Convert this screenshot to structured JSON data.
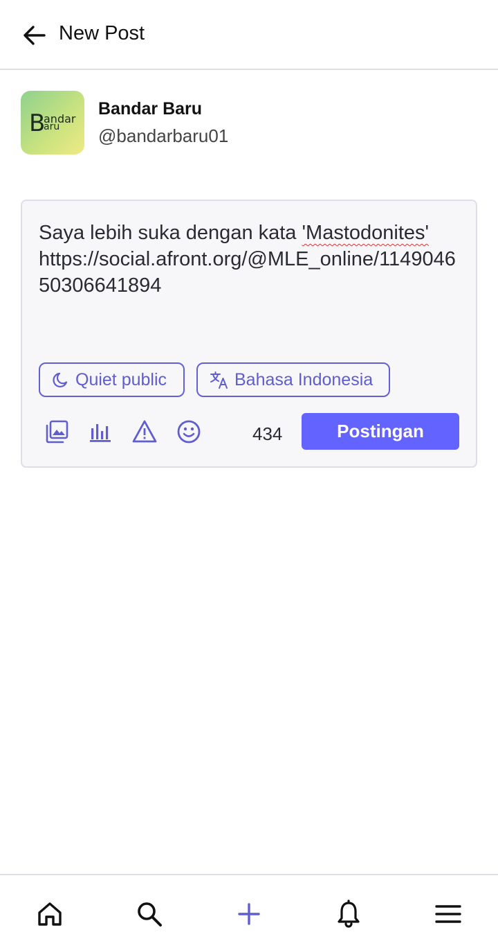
{
  "header": {
    "title": "New Post",
    "back_icon": "arrow-left-icon"
  },
  "account": {
    "display_name": "Bandar Baru",
    "handle": "@bandarbaru01",
    "avatar_logo": {
      "big_letter": "B",
      "top_text": "andar",
      "bottom_text": "aru"
    }
  },
  "composer": {
    "text_line1": "Saya lebih suka dengan kata ",
    "text_spell": "'Mastodonites'",
    "text_link": "https://social.afront.org/@MLE_online/114904650306641894",
    "visibility": {
      "label": "Quiet public",
      "icon": "moon-icon"
    },
    "language": {
      "label": "Bahasa Indonesia",
      "icon": "translate-icon"
    },
    "tools": [
      "media-icon",
      "poll-icon",
      "warning-icon",
      "emoji-icon"
    ],
    "char_count": "434",
    "post_label": "Postingan"
  },
  "bottom_nav": [
    "home-icon",
    "search-icon",
    "plus-icon",
    "bell-icon",
    "menu-icon"
  ],
  "colors": {
    "accent": "#6363ff",
    "chip": "#5f5dd0",
    "border": "#dedee4"
  }
}
